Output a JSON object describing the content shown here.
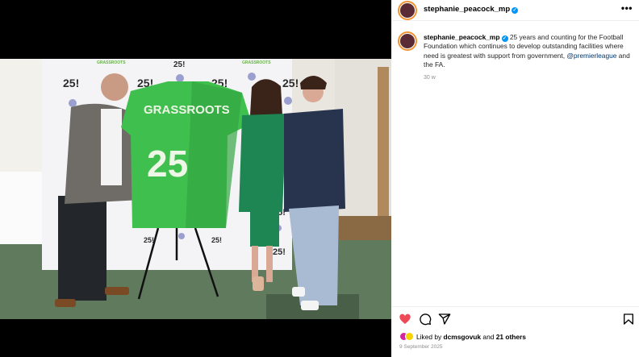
{
  "post": {
    "username": "stephanie_peacock_mp",
    "verified_icon": "verified-badge-icon",
    "more_icon": "more-options-icon"
  },
  "photo": {
    "jersey_title": "GRASSROOTS",
    "jersey_number": "25",
    "backdrop_logo": "25!",
    "backdrop_small": "GRASSROOTS"
  },
  "caption": {
    "username": "stephanie_peacock_mp",
    "text_part1": "25 years and counting for the Football Foundation which continues to develop outstanding facilities where need is greatest with support from government,",
    "mention": "@premierleague",
    "text_part2": " and the FA.",
    "time": "30 w"
  },
  "actions": {
    "like_icon": "heart-icon",
    "comment_icon": "comment-icon",
    "share_icon": "share-icon",
    "save_icon": "bookmark-icon",
    "like_color": "#ed4956"
  },
  "likes": {
    "prefix": "Liked by ",
    "user": "dcmsgovuk",
    "middle": " and ",
    "others": "21 others"
  },
  "date": "9 September 2025"
}
